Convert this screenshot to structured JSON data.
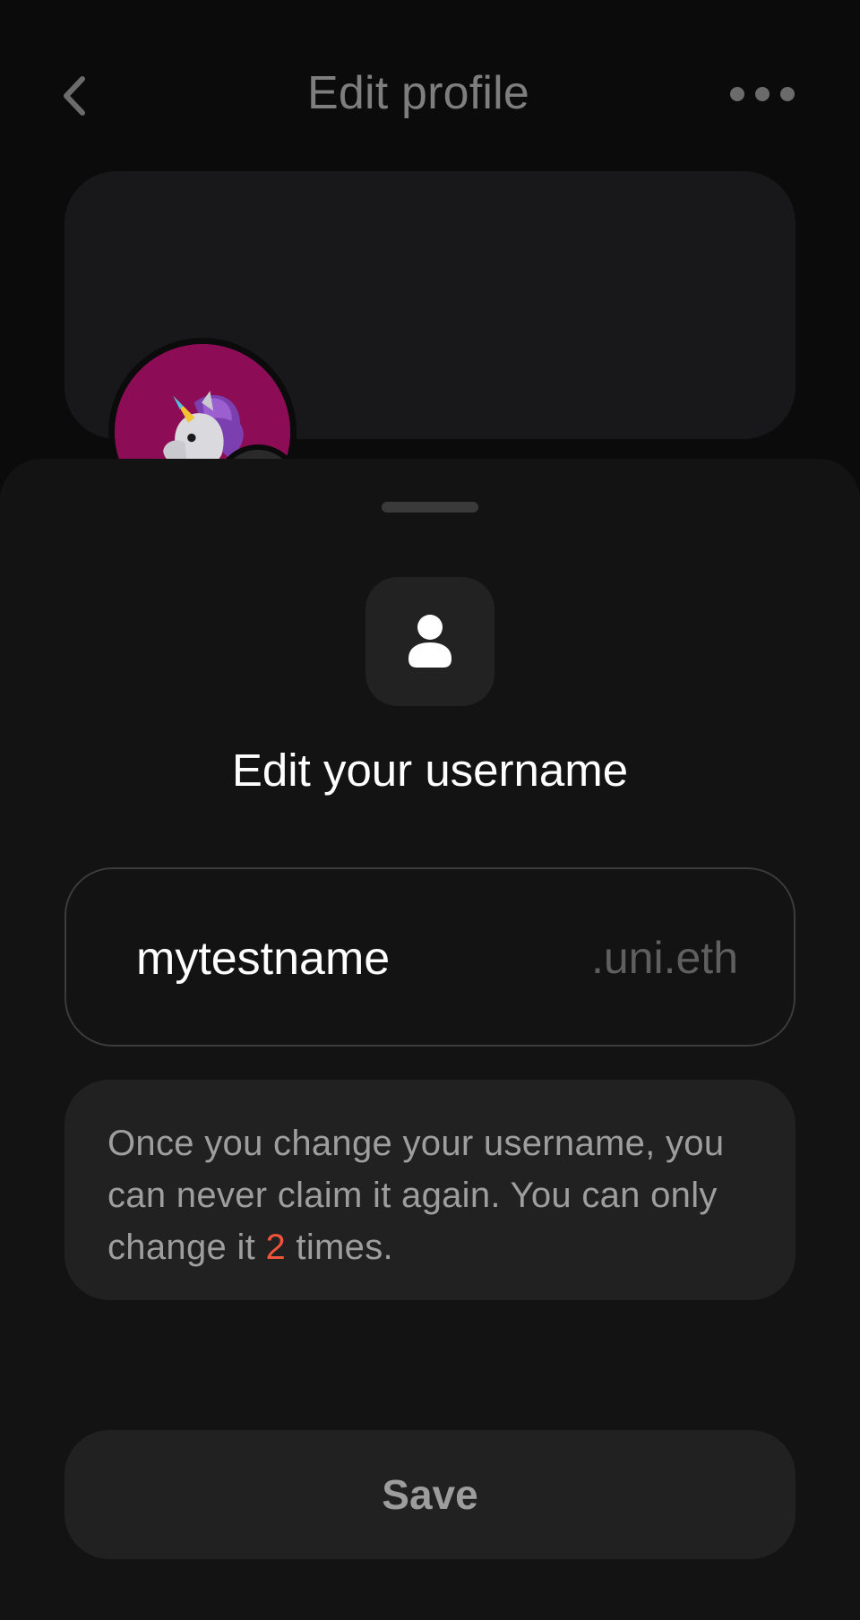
{
  "header": {
    "title": "Edit profile",
    "back_icon": "chevron-left-icon",
    "more_icon": "more-horizontal-icon"
  },
  "profile": {
    "avatar_emoji": "unicorn",
    "avatar_bg_color": "#8c0d55"
  },
  "sheet": {
    "icon": "user-icon",
    "title": "Edit your username",
    "username_field": {
      "value": "mytestname",
      "suffix": ".uni.eth"
    },
    "warning": {
      "text_before": "Once you change your username, you can never claim it again. You can only change it ",
      "count": "2",
      "text_after": " times.",
      "count_color": "#f0553b"
    },
    "save_label": "Save"
  }
}
